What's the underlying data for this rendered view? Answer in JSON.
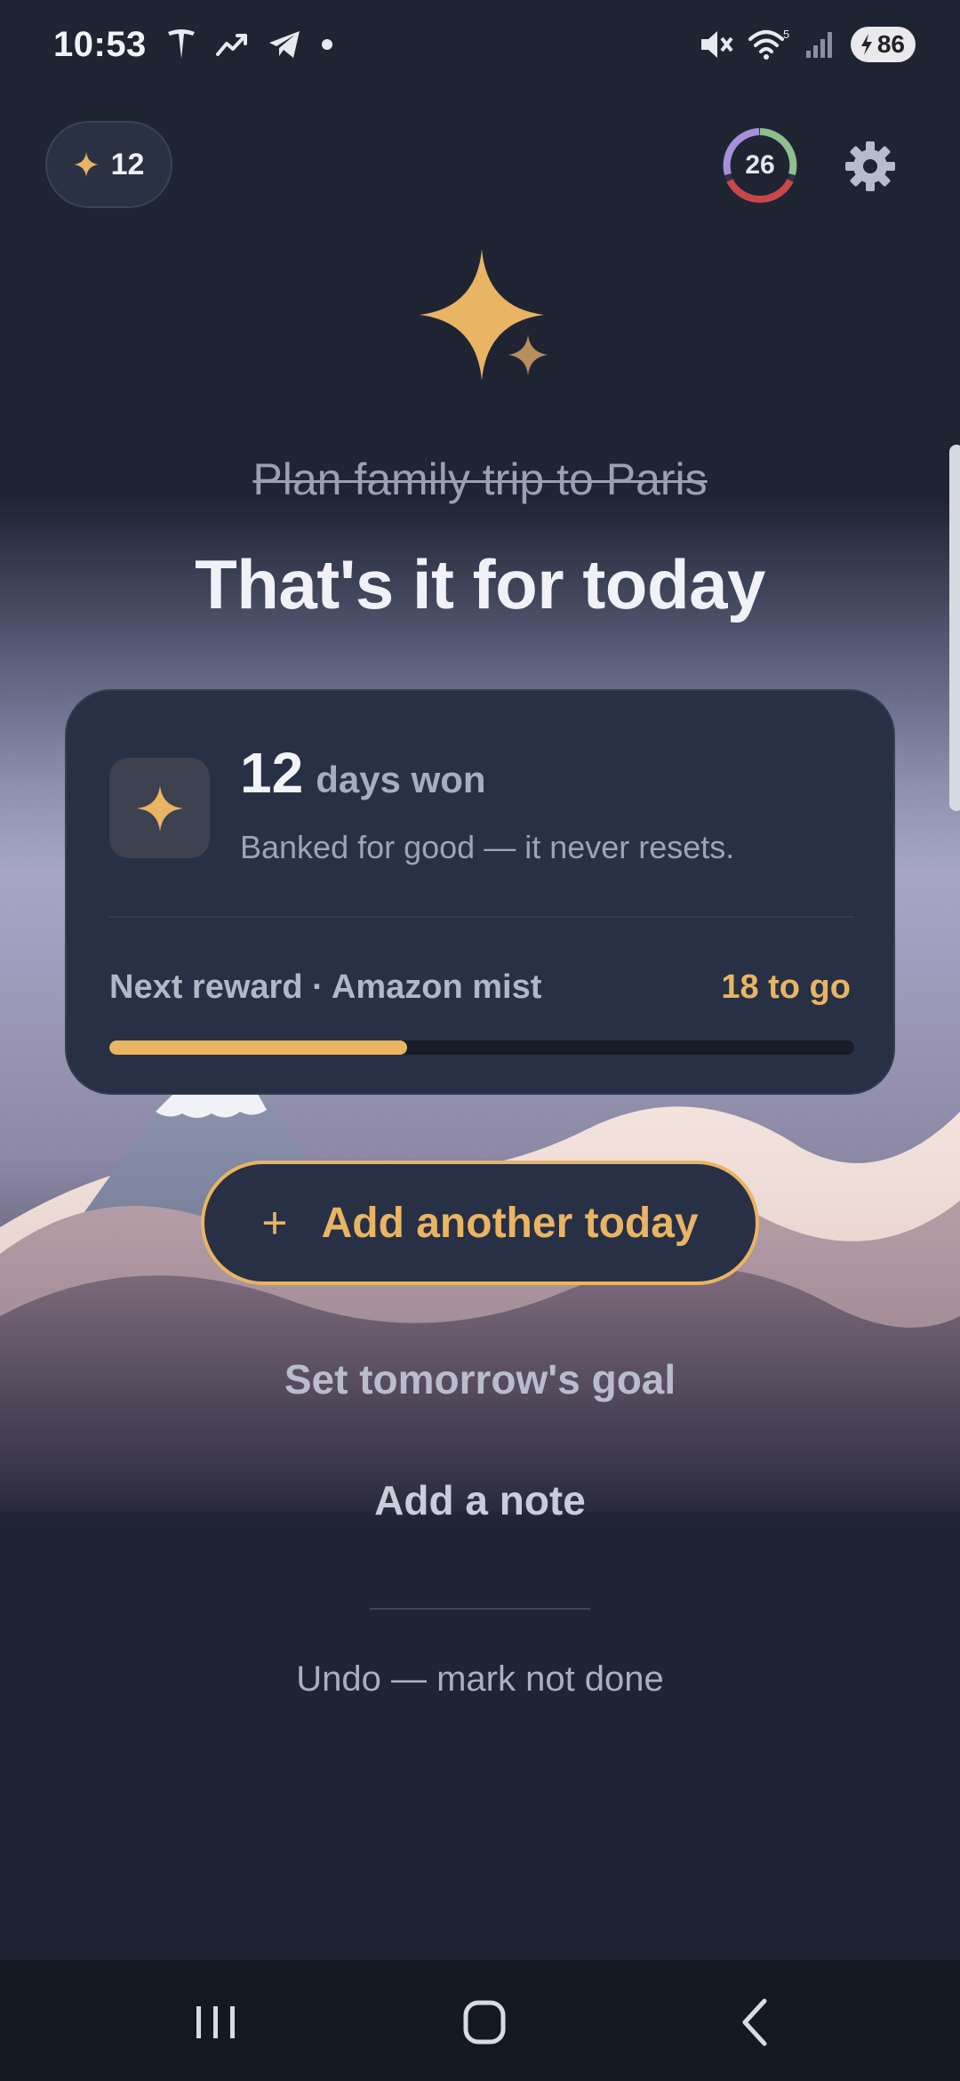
{
  "status_bar": {
    "time": "10:53",
    "battery": "86",
    "icons": [
      "tesla-icon",
      "trend-icon",
      "telegram-icon",
      "dot-icon",
      "mute-icon",
      "wifi-icon",
      "signal-icon",
      "battery-icon"
    ]
  },
  "top_bar": {
    "streak_count": "12",
    "ring_value": "26"
  },
  "task": {
    "completed_title": "Plan family trip to Paris",
    "headline": "That's it for today"
  },
  "card": {
    "days_count": "12",
    "days_label": "days won",
    "subtitle": "Banked for good — it never resets.",
    "reward_label": "Next reward · Amazon mist",
    "reward_remaining": "18 to go",
    "progress": 0.4
  },
  "actions": {
    "add_another": "Add another today",
    "add_plus": "+",
    "set_goal": "Set tomorrow's goal",
    "add_note": "Add a note",
    "undo": "Undo — mark not done"
  },
  "colors": {
    "accent": "#e9b463",
    "background": "#1f2433",
    "card": "#273044"
  }
}
